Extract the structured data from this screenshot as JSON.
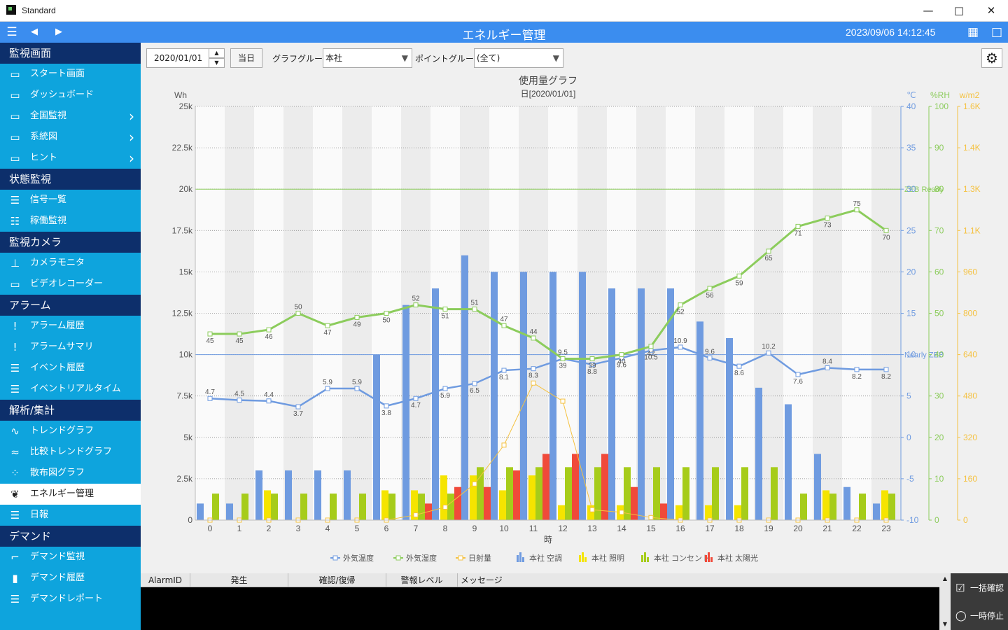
{
  "window": {
    "title": "Standard"
  },
  "header": {
    "title": "エネルギー管理",
    "datetime": "2023/09/06 14:12:45"
  },
  "sidebar": [
    {
      "label": "監視画面",
      "items": [
        {
          "label": "スタート画面",
          "icon": "monitor-icon"
        },
        {
          "label": "ダッシュボード",
          "icon": "monitor-icon"
        },
        {
          "label": "全国監視",
          "icon": "monitor-icon",
          "chevron": true
        },
        {
          "label": "系統図",
          "icon": "monitor-icon",
          "chevron": true
        },
        {
          "label": "ヒント",
          "icon": "monitor-icon",
          "chevron": true
        }
      ]
    },
    {
      "label": "状態監視",
      "items": [
        {
          "label": "信号一覧",
          "icon": "list-icon"
        },
        {
          "label": "稼働監視",
          "icon": "operation-icon"
        }
      ]
    },
    {
      "label": "監視カメラ",
      "items": [
        {
          "label": "カメラモニタ",
          "icon": "camera-icon"
        },
        {
          "label": "ビデオレコーダー",
          "icon": "recorder-icon"
        }
      ]
    },
    {
      "label": "アラーム",
      "items": [
        {
          "label": "アラーム履歴",
          "icon": "alert-icon"
        },
        {
          "label": "アラームサマリ",
          "icon": "alert-icon"
        },
        {
          "label": "イベント履歴",
          "icon": "event-list-icon"
        },
        {
          "label": "イベントリアルタイム",
          "icon": "event-clock-icon"
        }
      ]
    },
    {
      "label": "解析/集計",
      "items": [
        {
          "label": "トレンドグラフ",
          "icon": "trend-icon"
        },
        {
          "label": "比較トレンドグラフ",
          "icon": "compare-trend-icon"
        },
        {
          "label": "散布図グラフ",
          "icon": "scatter-icon"
        },
        {
          "label": "エネルギー管理",
          "icon": "leaf-icon",
          "active": true
        },
        {
          "label": "日報",
          "icon": "report-icon"
        }
      ]
    },
    {
      "label": "デマンド",
      "items": [
        {
          "label": "デマンド監視",
          "icon": "demand-icon"
        },
        {
          "label": "デマンド履歴",
          "icon": "bar-chart-icon"
        },
        {
          "label": "デマンドレポート",
          "icon": "report-icon"
        }
      ]
    }
  ],
  "toolbar": {
    "date": "2020/01/01",
    "today_label": "当日",
    "graph_group_label": "グラフグループ:",
    "graph_group_value": "本社",
    "point_group_label": "ポイントグループ:",
    "point_group_value": "(全て)"
  },
  "colors": {
    "blue": "#6f9be0",
    "green": "#8ccc5c",
    "orange": "#f5c242",
    "yellow": "#f5e400",
    "lime": "#a6cc1a",
    "red": "#f04a3a"
  },
  "chart_data": {
    "type": "bar",
    "title": "使用量グラフ",
    "subtitle": "日[2020/01/01]",
    "xlabel": "時",
    "x": [
      0,
      1,
      2,
      3,
      4,
      5,
      6,
      7,
      8,
      9,
      10,
      11,
      12,
      13,
      14,
      15,
      16,
      17,
      18,
      19,
      20,
      21,
      22,
      23
    ],
    "axes": {
      "wh": {
        "label": "Wh",
        "range": [
          0,
          25000
        ],
        "ticks": [
          "0",
          "2.5k",
          "5k",
          "7.5k",
          "10k",
          "12.5k",
          "15k",
          "17.5k",
          "20k",
          "22.5k",
          "25k"
        ]
      },
      "temp": {
        "label": "℃",
        "range": [
          -10,
          40
        ]
      },
      "rh": {
        "label": "%RH",
        "range": [
          0,
          100
        ]
      },
      "solar": {
        "label": "w/m2",
        "range": [
          0,
          1600
        ],
        "ticks": [
          "0",
          "160",
          "320",
          "480",
          "640",
          "800",
          "960",
          "1.1K",
          "1.3K",
          "1.4K",
          "1.6K"
        ]
      }
    },
    "reference_lines": [
      {
        "label": "ZEB Ready",
        "axis": "wh",
        "value": 20000
      },
      {
        "label": "Nearly ZEB",
        "axis": "wh",
        "value": 10000
      }
    ],
    "series": [
      {
        "name": "本社 空調",
        "kind": "bar",
        "axis": "wh",
        "values": [
          1000,
          1000,
          3000,
          3000,
          3000,
          3000,
          10000,
          13000,
          14000,
          16000,
          15000,
          15000,
          15000,
          15000,
          14000,
          14000,
          14000,
          12000,
          11000,
          8000,
          7000,
          4000,
          2000,
          1000
        ]
      },
      {
        "name": "本社 照明",
        "kind": "bar",
        "axis": "wh",
        "values": [
          0,
          0,
          1800,
          0,
          0,
          0,
          1800,
          1800,
          2700,
          2700,
          1800,
          2700,
          900,
          900,
          900,
          0,
          900,
          900,
          900,
          0,
          0,
          1800,
          0,
          1800
        ]
      },
      {
        "name": "本社 コンセント",
        "kind": "bar",
        "axis": "wh",
        "values": [
          1600,
          1600,
          1600,
          1600,
          1600,
          1600,
          1600,
          1600,
          1600,
          3200,
          3200,
          3200,
          3200,
          3200,
          3200,
          3200,
          3200,
          3200,
          3200,
          3200,
          1600,
          1600,
          1600,
          1600
        ]
      },
      {
        "name": "本社 太陽光",
        "kind": "bar",
        "axis": "wh",
        "values": [
          0,
          0,
          0,
          0,
          0,
          0,
          0,
          1000,
          2000,
          2000,
          3000,
          4000,
          4000,
          4000,
          2000,
          1000,
          0,
          0,
          0,
          0,
          0,
          0,
          0,
          0
        ]
      },
      {
        "name": "外気温度",
        "kind": "line",
        "axis": "temp",
        "values": [
          4.7,
          4.5,
          4.4,
          3.7,
          5.9,
          5.9,
          3.8,
          4.7,
          5.9,
          6.5,
          8.1,
          8.3,
          9.5,
          8.8,
          9.6,
          10.5,
          10.9,
          9.6,
          8.6,
          10.2,
          7.6,
          8.4,
          8.2,
          8.2
        ],
        "labels": [
          "4.7",
          "4.5",
          "4.4",
          "3.7",
          "5.9",
          "5.9",
          "3.8",
          "4.7",
          "5.9",
          "6.5",
          "8.1",
          "8.3",
          "9.5",
          "8.8",
          "9.6",
          "10.5",
          "10.9",
          "9.6",
          "8.6",
          "10.2",
          "7.6",
          "8.4",
          "8.2",
          "8.2"
        ]
      },
      {
        "name": "外気湿度",
        "kind": "line",
        "axis": "rh",
        "values": [
          45,
          45,
          46,
          50,
          47,
          49,
          50,
          52,
          51,
          51,
          47,
          44,
          39,
          39,
          40,
          42,
          52,
          56,
          59,
          65,
          71,
          73,
          75,
          70
        ],
        "labels": [
          "45",
          "45",
          "46",
          "50",
          "47",
          "49",
          "50",
          "52",
          "51",
          "51",
          "47",
          "44",
          "39",
          "39",
          "40",
          "42",
          "52",
          "56",
          "59",
          "65",
          "71",
          "73",
          "75",
          "70"
        ]
      },
      {
        "name": "日射量",
        "kind": "line",
        "axis": "solar",
        "values": [
          0,
          0,
          0,
          0,
          0,
          0,
          0,
          20,
          50,
          140,
          290,
          530,
          460,
          40,
          30,
          10,
          0,
          0,
          0,
          0,
          0,
          0,
          0,
          0
        ]
      }
    ],
    "legend_position": "bottom"
  },
  "alarm_table": {
    "columns": [
      "AlarmID",
      "発生",
      "確認/復帰",
      "警報レベル",
      "メッセージ"
    ]
  },
  "side_buttons": {
    "confirm_all": "一括確認",
    "pause": "一時停止"
  }
}
